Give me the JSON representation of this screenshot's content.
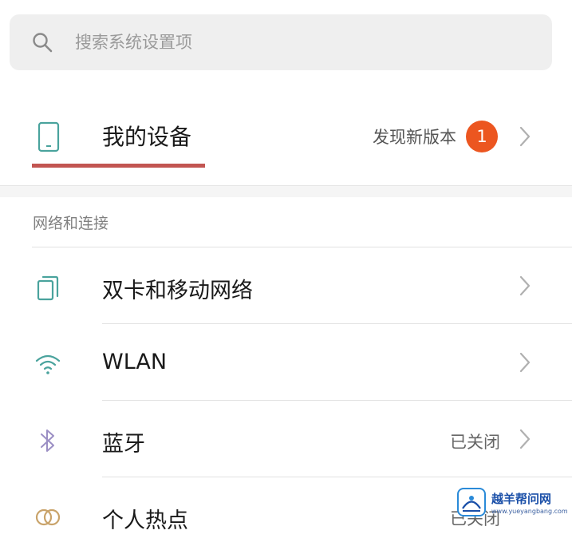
{
  "search": {
    "placeholder": "搜索系统设置项",
    "icon": "search-icon"
  },
  "my_device": {
    "title": "我的设备",
    "icon": "phone-icon",
    "update_text": "发现新版本",
    "badge_count": "1",
    "underline_color": "#c25551",
    "badge_color": "#ec5620"
  },
  "section": {
    "header": "网络和连接",
    "items": [
      {
        "label": "双卡和移动网络",
        "icon": "dual-sim-icon",
        "status": ""
      },
      {
        "label": "WLAN",
        "icon": "wifi-icon",
        "status": ""
      },
      {
        "label": "蓝牙",
        "icon": "bluetooth-icon",
        "status": "已关闭"
      },
      {
        "label": "个人热点",
        "icon": "hotspot-icon",
        "status": "已关闭"
      }
    ]
  },
  "watermark": {
    "title": "越羊帮问网",
    "url": "www.yueyangbang.com"
  },
  "colors": {
    "icon_teal": "#4aa39d",
    "icon_purple": "#9b8fc4",
    "icon_gold": "#c9a36a"
  }
}
